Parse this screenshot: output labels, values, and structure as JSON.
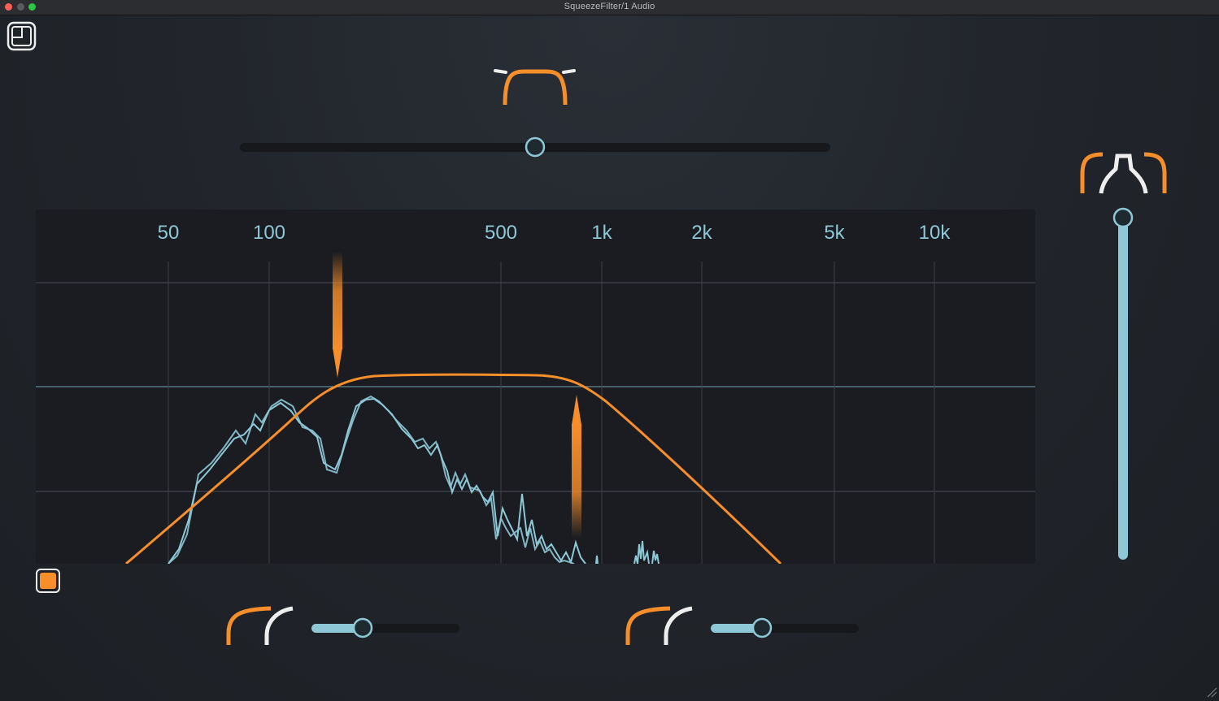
{
  "window": {
    "title": "SqueezeFilter/1 Audio"
  },
  "colors": {
    "accent": "#f68e2a",
    "spectrum": "#8ec7d6",
    "background": "#1f2228",
    "panel": "#1a1c21",
    "white": "#eeeeee"
  },
  "icons": {
    "toggle_view": "panel-layout-icon",
    "band_shape": "bandpass-curve-icon",
    "squeeze": "squeeze-icon",
    "low_slope": "slope-curve-icon",
    "high_slope": "slope-curve-icon"
  },
  "controls": {
    "band_width_slider": 0.5,
    "squeeze_slider": 1.0,
    "low_slope_slider": 0.35,
    "high_slope_slider": 0.35,
    "active_toggle": true
  },
  "spectrum_display": {
    "frequency_ticks": [
      "50",
      "100",
      "500",
      "1k",
      "2k",
      "5k",
      "10k"
    ]
  }
}
